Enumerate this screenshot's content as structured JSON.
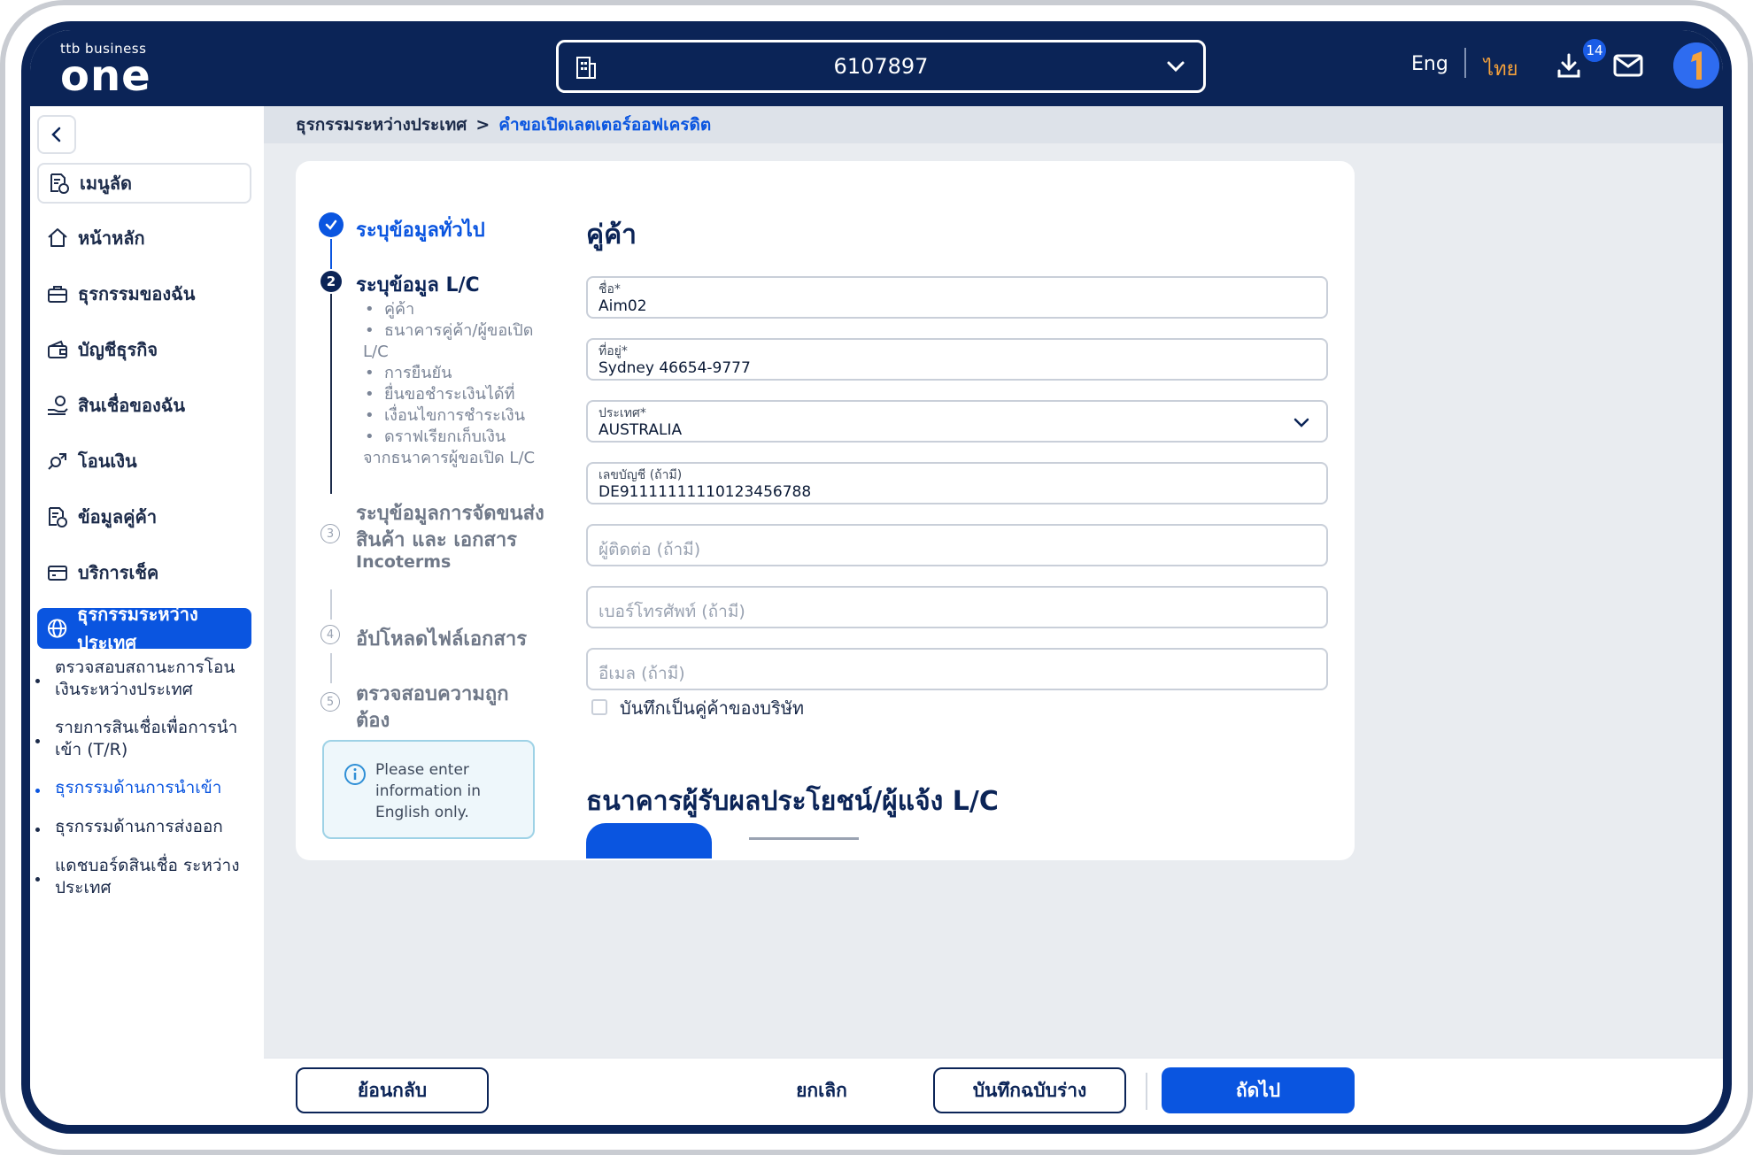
{
  "app": {
    "brand_small": "ttb business",
    "brand_large": "one"
  },
  "header": {
    "account_number": "6107897",
    "lang_eng": "Eng",
    "lang_thai": "ไทย",
    "download_badge": "14"
  },
  "sidebar": {
    "shortcut_label": "เมนูลัด",
    "items": [
      {
        "label": "หน้าหลัก",
        "icon": "home-icon"
      },
      {
        "label": "ธุรกรรมของฉัน",
        "icon": "briefcase-icon"
      },
      {
        "label": "บัญชีธุรกิจ",
        "icon": "wallet-icon"
      },
      {
        "label": "สินเชื่อของฉัน",
        "icon": "loan-icon"
      },
      {
        "label": "โอนเงิน",
        "icon": "transfer-icon"
      },
      {
        "label": "ข้อมูลคู่ค้า",
        "icon": "partner-doc-icon"
      },
      {
        "label": "บริการเช็ค",
        "icon": "cheque-icon"
      },
      {
        "label": "ธุรกรรมระหว่างประเทศ",
        "icon": "globe-icon"
      }
    ],
    "sub_items": [
      "ตรวจสอบสถานะการโอนเงินระหว่างประเทศ",
      "รายการสินเชื่อเพื่อการนำเข้า (T/R)",
      "ธุรกรรมด้านการนำเข้า",
      "ธุรกรรมด้านการส่งออก",
      "แดชบอร์ดสินเชื่อ ระหว่างประเทศ"
    ]
  },
  "breadcrumb": {
    "parent": "ธุรกรรมระหว่างประเทศ",
    "separator": ">",
    "current": "คำขอเปิดเลตเตอร์ออฟเครดิต"
  },
  "steps": {
    "s1": "ระบุข้อมูลทั่วไป",
    "s2": "ระบุข้อมูล L/C",
    "s2_num": "2",
    "s2_subs": [
      "คู่ค้า",
      "ธนาคารคู่ค้า/ผู้ขอเปิด",
      "L/C",
      "การยืนยัน",
      "ยื่นขอชำระเงินได้ที่",
      "เงื่อนไขการชำระเงิน",
      "ดราฟเรียกเก็บเงิน",
      "จากธนาคารผู้ขอเปิด L/C"
    ],
    "s3_line1": "ระบุข้อมูลการจัดขนส่ง",
    "s3_line2": "สินค้า และ เอกสาร",
    "s3_line3": "Incoterms",
    "s3_num": "3",
    "s4": "อัปโหลดไฟล์เอกสาร",
    "s4_num": "4",
    "s5_line1": "ตรวจสอบความถูก",
    "s5_line2": "ต้อง",
    "s5_num": "5"
  },
  "info": {
    "text": "Please enter information in English only."
  },
  "form": {
    "section_title": "คู่ค้า",
    "name_label": "ชื่อ*",
    "name_value": "Aim02",
    "address_label": "ที่อยู่*",
    "address_value": "Sydney 46654-9777",
    "country_label": "ประเทศ*",
    "country_value": "AUSTRALIA",
    "account_label": "เลขบัญชี (ถ้ามี)",
    "account_value": "DE91111111110123456788",
    "contact_placeholder": "ผู้ติดต่อ (ถ้ามี)",
    "phone_placeholder": "เบอร์โทรศัพท์ (ถ้ามี)",
    "email_placeholder": "อีเมล (ถ้ามี)",
    "save_partner_label": "บันทึกเป็นคู่ค้าของบริษัท",
    "bank_section_title": "ธนาคารผู้รับผลประโยชน์/ผู้แจ้ง L/C"
  },
  "footer": {
    "back": "ย้อนกลับ",
    "cancel": "ยกเลิก",
    "save_draft": "บันทึกฉบับร่าง",
    "next": "ถัดไป"
  },
  "colors": {
    "navy": "#0b2457",
    "primary": "#0a55e0",
    "accent_orange": "#f6a23b"
  }
}
